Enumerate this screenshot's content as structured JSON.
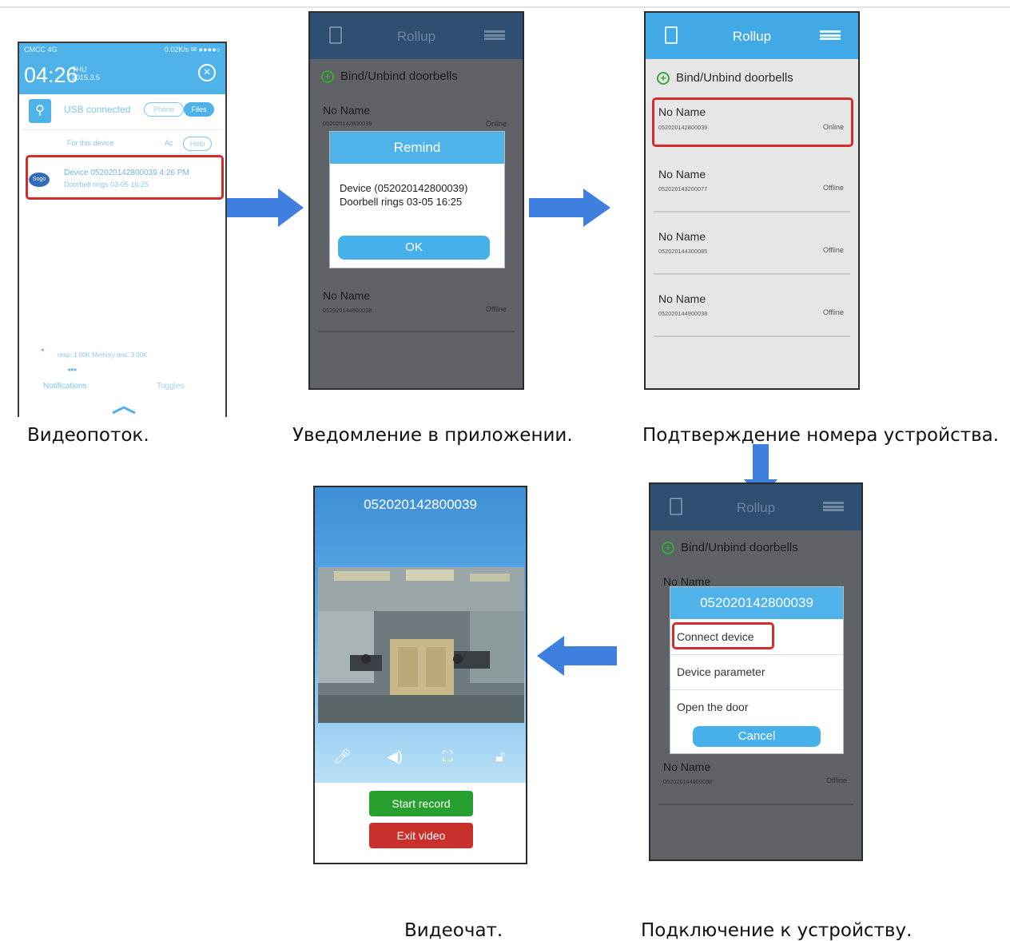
{
  "captions": {
    "stream": "Видеопоток.",
    "notification": "Уведомление в приложении.",
    "confirm": "Подтверждение номера устройства.",
    "videochat": "Видеочат.",
    "connect": "Подключение к устройству."
  },
  "phone1": {
    "carrier": "CMCC 4G",
    "status_right": "0.02K/s ✉ ●●●●○",
    "time": "04:26",
    "day": "THU",
    "date": "2015.3.5",
    "usb_text": "USB connected",
    "usb_phone": "Phone",
    "usb_files": "Files",
    "for_device": "For this device",
    "ac": "Ac",
    "help": "Help",
    "notif_line1": "Device  052020142800039   4:26 PM",
    "notif_line2": "Doorbell rings 03-05 16:25",
    "speed": "resp: 1.00K    Memory test: 3.00K",
    "notifications": "Notifications",
    "toggles": "Toggles",
    "dev_icon_text": "Sogo"
  },
  "app": {
    "title": "Rollup",
    "bind_label": "Bind/Unbind doorbells",
    "no_name": "No Name",
    "online": "Online",
    "offline": "Offline",
    "ids": [
      "052020142800039",
      "052020143200077",
      "052020144300085",
      "052020144900038"
    ]
  },
  "remind_dialog": {
    "title": "Remind",
    "line1": "Device  (052020142800039)",
    "line2": "Doorbell rings 03-05 16:25",
    "ok": "OK"
  },
  "connect_dialog": {
    "title": "052020142800039",
    "opt1": "Connect device",
    "opt2": "Device parameter",
    "opt3": "Open the door",
    "cancel": "Cancel"
  },
  "video": {
    "title": "052020142800039",
    "start_record": "Start record",
    "exit_video": "Exit video",
    "icons": [
      "mic-icon",
      "speaker-icon",
      "fullscreen-icon",
      "unlock-icon"
    ]
  },
  "colors": {
    "accent_blue": "#4fb3ea",
    "arrow_blue": "#3f7fe0",
    "highlight_red": "#d62b2b",
    "record_green": "#27a02f",
    "exit_red": "#c9302c"
  }
}
